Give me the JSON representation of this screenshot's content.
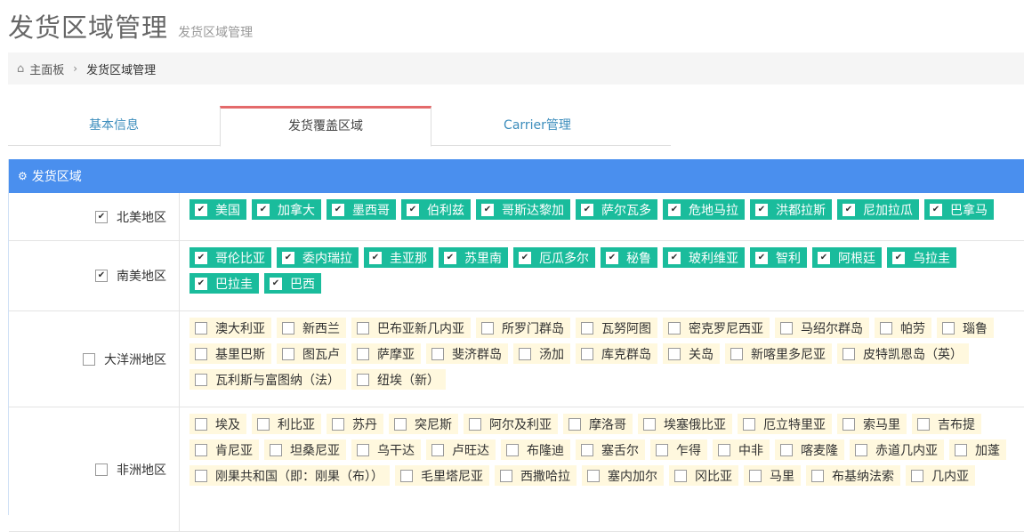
{
  "header": {
    "title": "发货区域管理",
    "subtitle": "发货区域管理"
  },
  "breadcrumb": {
    "home_label": "主面板",
    "current": "发货区域管理"
  },
  "tabs": [
    {
      "label": "基本信息"
    },
    {
      "label": "发货覆盖区域"
    },
    {
      "label": "Carrier管理"
    }
  ],
  "panel": {
    "title": "发货区域"
  },
  "colors": {
    "panel_header": "#4a8fee",
    "chip_checked": "#1abc9c",
    "chip_unchecked": "#fff8de",
    "tab_active_border": "#e46a6b"
  },
  "regions": [
    {
      "label": "北美地区",
      "checked": true,
      "countries": [
        {
          "name": "美国",
          "checked": true
        },
        {
          "name": "加拿大",
          "checked": true
        },
        {
          "name": "墨西哥",
          "checked": true
        },
        {
          "name": "伯利兹",
          "checked": true
        },
        {
          "name": "哥斯达黎加",
          "checked": true
        },
        {
          "name": "萨尔瓦多",
          "checked": true
        },
        {
          "name": "危地马拉",
          "checked": true
        },
        {
          "name": "洪都拉斯",
          "checked": true
        },
        {
          "name": "尼加拉瓜",
          "checked": true
        },
        {
          "name": "巴拿马",
          "checked": true
        }
      ]
    },
    {
      "label": "南美地区",
      "checked": true,
      "countries": [
        {
          "name": "哥伦比亚",
          "checked": true
        },
        {
          "name": "委内瑞拉",
          "checked": true
        },
        {
          "name": "圭亚那",
          "checked": true
        },
        {
          "name": "苏里南",
          "checked": true
        },
        {
          "name": "厄瓜多尔",
          "checked": true
        },
        {
          "name": "秘鲁",
          "checked": true
        },
        {
          "name": "玻利维亚",
          "checked": true
        },
        {
          "name": "智利",
          "checked": true
        },
        {
          "name": "阿根廷",
          "checked": true
        },
        {
          "name": "乌拉圭",
          "checked": true
        },
        {
          "name": "巴拉圭",
          "checked": true
        },
        {
          "name": "巴西",
          "checked": true
        }
      ]
    },
    {
      "label": "大洋洲地区",
      "checked": false,
      "countries": [
        {
          "name": "澳大利亚",
          "checked": false
        },
        {
          "name": "新西兰",
          "checked": false
        },
        {
          "name": "巴布亚新几内亚",
          "checked": false
        },
        {
          "name": "所罗门群岛",
          "checked": false
        },
        {
          "name": "瓦努阿图",
          "checked": false
        },
        {
          "name": "密克罗尼西亚",
          "checked": false
        },
        {
          "name": "马绍尔群岛",
          "checked": false
        },
        {
          "name": "帕劳",
          "checked": false
        },
        {
          "name": "瑙鲁",
          "checked": false
        },
        {
          "name": "基里巴斯",
          "checked": false
        },
        {
          "name": "图瓦卢",
          "checked": false
        },
        {
          "name": "萨摩亚",
          "checked": false
        },
        {
          "name": "斐济群岛",
          "checked": false
        },
        {
          "name": "汤加",
          "checked": false
        },
        {
          "name": "库克群岛",
          "checked": false
        },
        {
          "name": "关岛",
          "checked": false
        },
        {
          "name": "新喀里多尼亚",
          "checked": false
        },
        {
          "name": "皮特凯恩岛（英）",
          "checked": false
        },
        {
          "name": "瓦利斯与富图纳（法）",
          "checked": false
        },
        {
          "name": "纽埃（新）",
          "checked": false
        }
      ]
    },
    {
      "label": "非洲地区",
      "checked": false,
      "countries": [
        {
          "name": "埃及",
          "checked": false
        },
        {
          "name": "利比亚",
          "checked": false
        },
        {
          "name": "苏丹",
          "checked": false
        },
        {
          "name": "突尼斯",
          "checked": false
        },
        {
          "name": "阿尔及利亚",
          "checked": false
        },
        {
          "name": "摩洛哥",
          "checked": false
        },
        {
          "name": "埃塞俄比亚",
          "checked": false
        },
        {
          "name": "厄立特里亚",
          "checked": false
        },
        {
          "name": "索马里",
          "checked": false
        },
        {
          "name": "吉布提",
          "checked": false
        },
        {
          "name": "肯尼亚",
          "checked": false
        },
        {
          "name": "坦桑尼亚",
          "checked": false
        },
        {
          "name": "乌干达",
          "checked": false
        },
        {
          "name": "卢旺达",
          "checked": false
        },
        {
          "name": "布隆迪",
          "checked": false
        },
        {
          "name": "塞舌尔",
          "checked": false
        },
        {
          "name": "乍得",
          "checked": false
        },
        {
          "name": "中非",
          "checked": false
        },
        {
          "name": "喀麦隆",
          "checked": false
        },
        {
          "name": "赤道几内亚",
          "checked": false
        },
        {
          "name": "加蓬",
          "checked": false
        },
        {
          "name": "刚果共和国（即：刚果（布））",
          "checked": false
        },
        {
          "name": "毛里塔尼亚",
          "checked": false
        },
        {
          "name": "西撒哈拉",
          "checked": false
        },
        {
          "name": "塞内加尔",
          "checked": false
        },
        {
          "name": "冈比亚",
          "checked": false
        },
        {
          "name": "马里",
          "checked": false
        },
        {
          "name": "布基纳法索",
          "checked": false
        },
        {
          "name": "几内亚",
          "checked": false
        }
      ]
    }
  ]
}
